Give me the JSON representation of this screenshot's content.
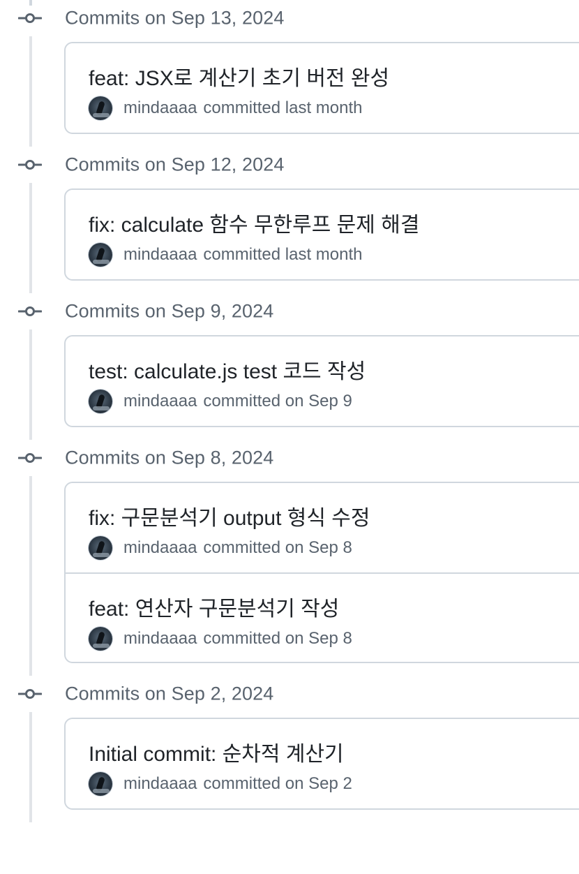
{
  "groups": [
    {
      "heading": "Commits on Sep 13, 2024",
      "commits": [
        {
          "title": "feat: JSX로 계산기 초기 버전 완성",
          "author": "mindaaaa",
          "when": "committed last month"
        }
      ]
    },
    {
      "heading": "Commits on Sep 12, 2024",
      "commits": [
        {
          "title": "fix: calculate 함수 무한루프 문제 해결",
          "author": "mindaaaa",
          "when": "committed last month"
        }
      ]
    },
    {
      "heading": "Commits on Sep 9, 2024",
      "commits": [
        {
          "title": "test: calculate.js test 코드 작성",
          "author": "mindaaaa",
          "when": "committed on Sep 9"
        }
      ]
    },
    {
      "heading": "Commits on Sep 8, 2024",
      "commits": [
        {
          "title": "fix: 구문분석기 output 형식 수정",
          "author": "mindaaaa",
          "when": "committed on Sep 8"
        },
        {
          "title": "feat: 연산자 구문분석기 작성",
          "author": "mindaaaa",
          "when": "committed on Sep 8"
        }
      ]
    },
    {
      "heading": "Commits on Sep 2, 2024",
      "commits": [
        {
          "title": "Initial commit: 순차적 계산기",
          "author": "mindaaaa",
          "when": "committed on Sep 2"
        }
      ]
    }
  ],
  "icons": {
    "group_marker": "git-commit-icon",
    "avatar": "user-avatar"
  },
  "colors": {
    "muted_text": "#59636e",
    "title_text": "#1f2328",
    "border": "#d0d7de",
    "timeline": "#e1e4e8"
  }
}
